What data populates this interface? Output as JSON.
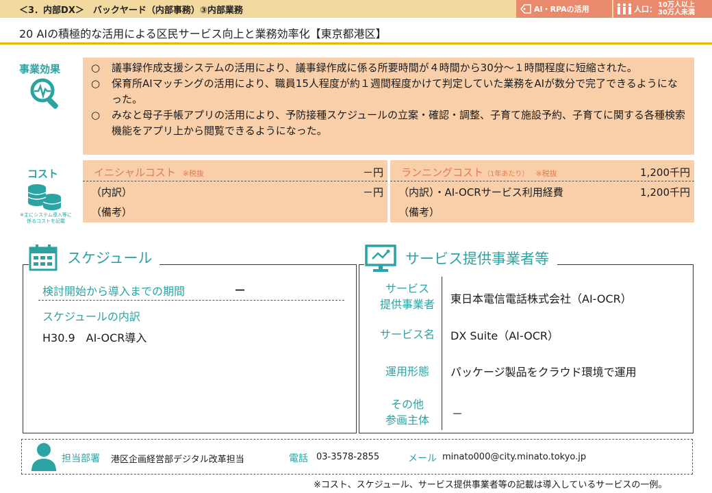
{
  "header": {
    "section": "＜3．内部DX＞　バックヤード（内部事務）③内部業務",
    "tag_ai": "AI・RPAの活用",
    "tag_pop_label": "人口：",
    "tag_pop_range_1": "10万人以上",
    "tag_pop_range_2": "30万人未満",
    "title": "20  AIの積極的な活用による区民サービス向上と業務効率化【東京都港区】"
  },
  "effect": {
    "label": "事業効果",
    "marker": "○",
    "items": [
      "議事録作成支援システムの活用により、議事録作成に係る所要時間が４時間から30分～１時間程度に短縮された。",
      "保育所AIマッチングの活用により、職員15人程度が約１週間程度かけて判定していた業務をAIが数分で完了できるようになった。",
      "みなと母子手帳アプリの活用により、予防接種スケジュールの立案・確認・調整、子育て施設予約、子育てに関する各種検索機能をアプリ上から閲覧できるようになった。"
    ]
  },
  "cost": {
    "label": "コスト",
    "note": "※主にシステム導入等に係るコストを記載",
    "initial": {
      "heading": "イニシャルコスト",
      "tax": "※税抜",
      "value": "－円",
      "breakdown_label": "（内訳）",
      "breakdown_value": "－円",
      "remarks_label": "（備考）"
    },
    "running": {
      "heading": "ランニングコスト",
      "per_year": "（1年あたり）",
      "tax": "※税抜",
      "value": "1,200千円",
      "breakdown_label": "（内訳）",
      "breakdown_item": "・AI-OCRサービス利用経費",
      "breakdown_value": "1,200千円",
      "remarks_label": "（備考）"
    }
  },
  "schedule": {
    "heading": "スケジュール",
    "period_label": "検討開始から導入までの期間",
    "period_value": "－",
    "breakdown_label": "スケジュールの内訳",
    "items": [
      "H30.9　AI-OCR導入"
    ]
  },
  "service": {
    "heading": "サービス提供事業者等",
    "rows": [
      {
        "label_1": "サービス",
        "label_2": "提供事業者",
        "value": "東日本電信電話株式会社（AI-OCR）"
      },
      {
        "label_1": "サービス名",
        "label_2": "",
        "value": "DX Suite（AI-OCR）"
      },
      {
        "label_1": "運用形態",
        "label_2": "",
        "value": "パッケージ製品をクラウド環境で運用"
      },
      {
        "label_1": "その他",
        "label_2": "参画主体",
        "value": "－"
      }
    ]
  },
  "contact": {
    "dept_label": "担当部署",
    "dept_value": "港区企画経営部デジタル改革担当",
    "tel_label": "電話",
    "tel_value": "03-3578-2855",
    "mail_label": "メール",
    "mail_value": "minato000@city.minato.tokyo.jp"
  },
  "footnote": "※コスト、スケジュール、サービス提供事業者等の記載は導入しているサービスの一例。",
  "colors": {
    "accent_teal": "#2ca3a3",
    "peach": "#f9cfaa",
    "orange_tag": "#e88a6b",
    "gold_rule": "#f0b400"
  }
}
